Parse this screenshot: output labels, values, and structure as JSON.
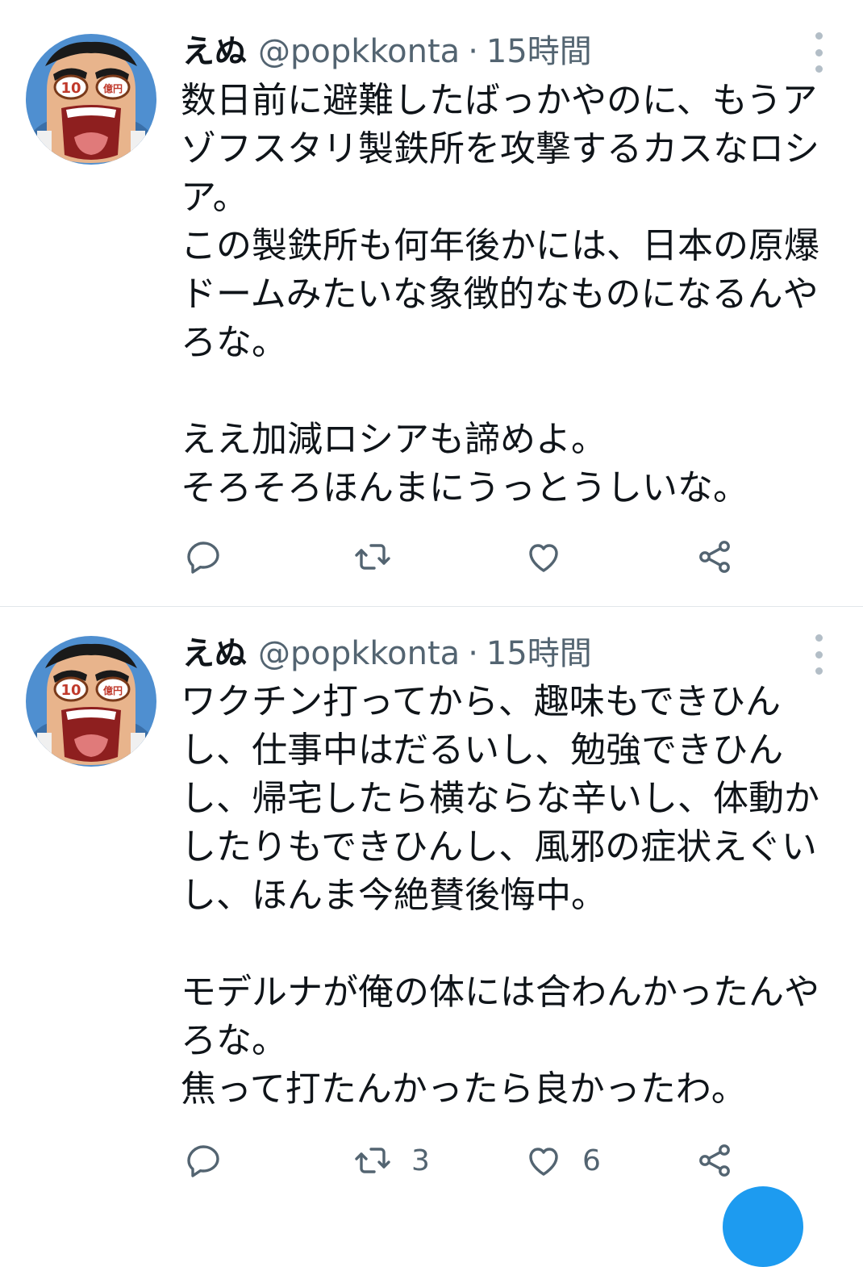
{
  "tweets": [
    {
      "display_name": "えぬ",
      "handle": "@popkkonta",
      "separator": "·",
      "time": "15時間",
      "lines": [
        "数日前に避難したばっかやのに、もうア",
        "ゾフスタリ製鉄所を攻撃するカスなロシ",
        "ア。",
        "この製鉄所も何年後かには、日本の原爆",
        "ドームみたいな象徴的なものになるんや",
        "ろな。",
        "",
        "ええ加減ロシアも諦めよ。",
        "そろそろほんまにうっとうしいな。"
      ],
      "actions": {
        "reply_count": "",
        "retweet_count": "",
        "like_count": ""
      },
      "icons": [
        "reply-icon",
        "retweet-icon",
        "like-icon",
        "share-icon",
        "more-icon"
      ]
    },
    {
      "display_name": "えぬ",
      "handle": "@popkkonta",
      "separator": "·",
      "time": "15時間",
      "lines": [
        "ワクチン打ってから、趣味もできひん",
        "し、仕事中はだるいし、勉強できひん",
        "し、帰宅したら横ならな辛いし、体動か",
        "したりもできひんし、風邪の症状えぐい",
        "し、ほんま今絶賛後悔中。",
        "",
        "モデルナが俺の体には合わんかったんや",
        "ろな。",
        "焦って打たんかったら良かったわ。"
      ],
      "actions": {
        "reply_count": "",
        "retweet_count": "3",
        "like_count": "6"
      },
      "icons": [
        "reply-icon",
        "retweet-icon",
        "like-icon",
        "share-icon",
        "more-icon"
      ]
    }
  ],
  "colors": {
    "text": "#0f1419",
    "secondary": "#536471",
    "divider": "#e1e6ea",
    "accent": "#1d9bf0"
  }
}
